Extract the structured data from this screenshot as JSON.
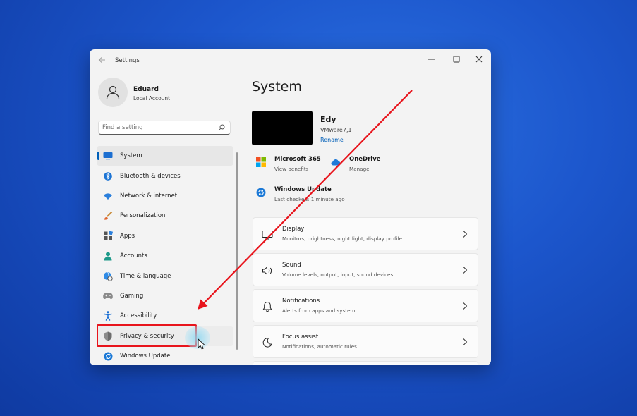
{
  "window": {
    "app_title": "Settings",
    "back_icon": "back-arrow-icon",
    "controls": [
      "minimize-icon",
      "maximize-icon",
      "close-icon"
    ]
  },
  "profile": {
    "name": "Eduard",
    "account_type": "Local Account"
  },
  "search": {
    "placeholder": "Find a setting"
  },
  "sidebar": {
    "items": [
      {
        "label": "System",
        "icon": "monitor-icon",
        "selected": true
      },
      {
        "label": "Bluetooth & devices",
        "icon": "bluetooth-icon"
      },
      {
        "label": "Network & internet",
        "icon": "wifi-icon"
      },
      {
        "label": "Personalization",
        "icon": "brush-icon"
      },
      {
        "label": "Apps",
        "icon": "apps-icon"
      },
      {
        "label": "Accounts",
        "icon": "person-icon"
      },
      {
        "label": "Time & language",
        "icon": "globe-clock-icon"
      },
      {
        "label": "Gaming",
        "icon": "gamepad-icon"
      },
      {
        "label": "Accessibility",
        "icon": "accessibility-icon"
      },
      {
        "label": "Privacy & security",
        "icon": "shield-icon",
        "highlighted": true
      },
      {
        "label": "Windows Update",
        "icon": "windows-update-icon"
      }
    ]
  },
  "main": {
    "title": "System",
    "device": {
      "name": "Edy",
      "model": "VMware7,1",
      "rename_label": "Rename"
    },
    "quick_links": [
      {
        "title": "Microsoft 365",
        "subtitle": "View benefits",
        "icon": "microsoft-365-icon"
      },
      {
        "title": "OneDrive",
        "subtitle": "Manage",
        "icon": "onedrive-cloud-icon"
      },
      {
        "title": "Windows Update",
        "subtitle": "Last checked: 1 minute ago",
        "icon": "windows-update-icon"
      }
    ],
    "cards": [
      {
        "title": "Display",
        "subtitle": "Monitors, brightness, night light, display profile",
        "icon": "display-icon"
      },
      {
        "title": "Sound",
        "subtitle": "Volume levels, output, input, sound devices",
        "icon": "speaker-icon"
      },
      {
        "title": "Notifications",
        "subtitle": "Alerts from apps and system",
        "icon": "bell-icon"
      },
      {
        "title": "Focus assist",
        "subtitle": "Notifications, automatic rules",
        "icon": "moon-icon"
      }
    ]
  },
  "colors": {
    "accent": "#005fb8",
    "annotation_red": "#e8141c",
    "desktop_blue": "#1c56cc"
  }
}
